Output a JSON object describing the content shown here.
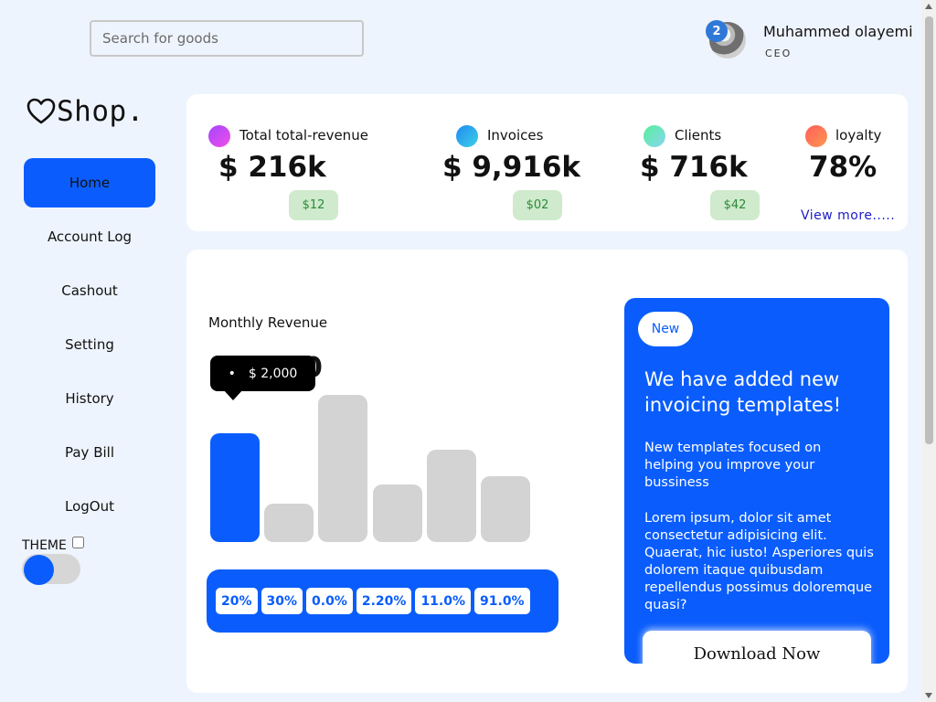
{
  "search": {
    "placeholder": "Search for goods"
  },
  "profile": {
    "name": "Muhammed olayemi",
    "role": "CEO",
    "notification_count": "2"
  },
  "logo": {
    "text": "Shop.",
    "icon": "heart-icon"
  },
  "nav": {
    "items": [
      {
        "label": "Home",
        "active": true
      },
      {
        "label": "Account Log"
      },
      {
        "label": "Cashout"
      },
      {
        "label": "Setting"
      },
      {
        "label": "History"
      },
      {
        "label": "Pay Bill"
      },
      {
        "label": "LogOut"
      }
    ]
  },
  "theme": {
    "label": "THEME",
    "checked": false
  },
  "stats": [
    {
      "label": "Total total-revenue",
      "value": "$ 216k",
      "pill": "$12",
      "color_from": "#a445ff",
      "color_to": "#f04fe6"
    },
    {
      "label": "Invoices",
      "value": "$ 9,916k",
      "pill": "$02",
      "color_from": "#1f8bf0",
      "color_to": "#3ed0e8"
    },
    {
      "label": "Clients",
      "value": "$ 716k",
      "pill": "$42",
      "color_from": "#56ef9a",
      "color_to": "#8ad6f0"
    },
    {
      "label": "loyalty",
      "value": "78%",
      "pill": null,
      "color_from": "#ff5c5c",
      "color_to": "#ff9a4f"
    }
  ],
  "view_more": "View more.....",
  "chart": {
    "title": "Monthly Revenue",
    "value_partial": "0",
    "tooltip": "$ 2,000",
    "percentages": [
      "20%",
      "30%",
      "0.0%",
      "2.20%",
      "11.0%",
      "91.0%"
    ]
  },
  "chart_data": {
    "type": "bar",
    "title": "Monthly Revenue",
    "values": [
      2000,
      700,
      2700,
      1060,
      1700,
      1200
    ],
    "ylim": [
      0,
      2750
    ],
    "highlight_index": 0
  },
  "promo": {
    "tag": "New",
    "title": "We have added new invoicing templates!",
    "subtitle": "New templates focused on helping you improve your bussiness",
    "body": "Lorem ipsum, dolor sit amet consectetur adipisicing elit. Quaerat, hic iusto! Asperiores quis dolorem itaque quibusdam repellendus possimus doloremque quasi?",
    "button": "Download Now"
  },
  "colors": {
    "accent": "#0a5dfc",
    "page_bg": "#eef4fd",
    "pill_bg": "#cfeacc",
    "pill_text": "#2c8a36",
    "bar_inactive": "#d3d3d3"
  }
}
